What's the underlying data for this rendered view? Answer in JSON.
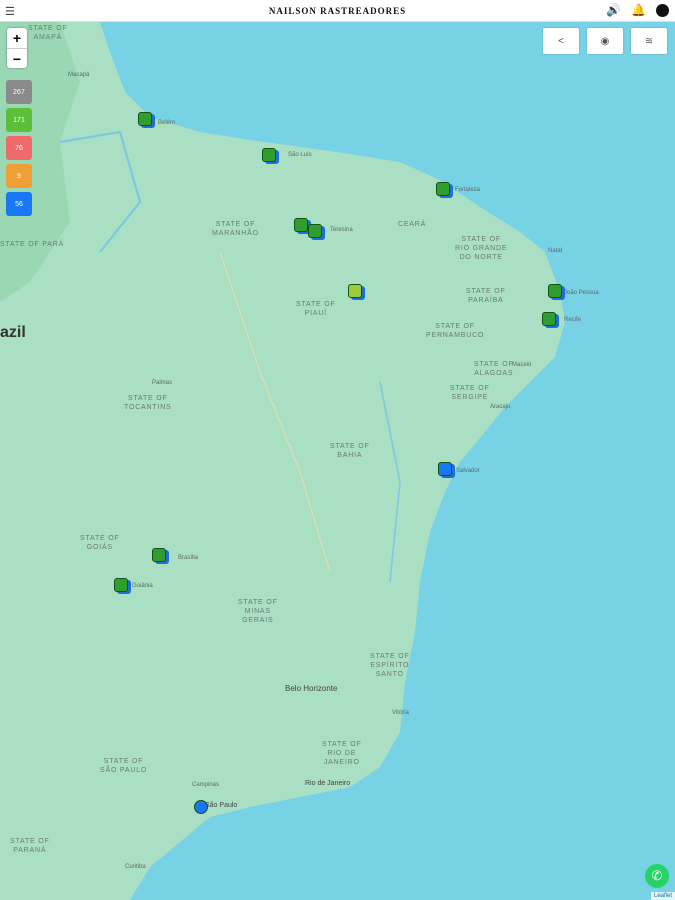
{
  "header": {
    "title": "NAILSON RASTREADORES",
    "menu_icon": "hamburger-icon",
    "sound_icon": "speaker-icon",
    "bell_icon": "bell-icon",
    "user_icon": "user-icon"
  },
  "zoom": {
    "in": "+",
    "out": "−"
  },
  "counts": [
    {
      "value": "267",
      "color": "#8a8a8a"
    },
    {
      "value": "171",
      "color": "#5cbf3a"
    },
    {
      "value": "76",
      "color": "#ef6a6a"
    },
    {
      "value": "9",
      "color": "#eea036"
    },
    {
      "value": "56",
      "color": "#1877f2"
    }
  ],
  "toolbar": {
    "share_icon": "share-icon",
    "eye_icon": "eye-icon",
    "layers_icon": "layers-icon"
  },
  "attribution": "Leaflet",
  "country_label": "azil",
  "states": [
    "STATE OF\nAMAPÁ",
    "STATE OF\nMARANHÃO",
    "CEARÁ",
    "STATE OF\nRIO GRANDE\nDO NORTE",
    "STATE OF\nPARAÍBA",
    "STATE OF\nPIAUÍ",
    "STATE OF\nPERNAMBUCO",
    "STATE OF\nALAGOAS",
    "STATE OF\nSERGIPE",
    "STATE OF\nTOCANTINS",
    "STATE OF\nBAHIA",
    "STATE OF\nGOIÁS",
    "STATE OF\nMINAS\nGERAIS",
    "STATE OF\nESPÍRITO\nSANTO",
    "STATE OF\nRIO DE\nJANEIRO",
    "STATE OF\nSÃO PAULO",
    "STATE OF\nPARANÁ",
    "STATE OF PARÁ"
  ],
  "cities": [
    "Belém",
    "São Luís",
    "Fortaleza",
    "Teresina",
    "Natal",
    "João Pessoa",
    "Recife",
    "Salvador",
    "Brasília",
    "Goiânia",
    "Belo Horizonte",
    "Rio de Janeiro",
    "São Paulo",
    "Campinas",
    "Curitiba",
    "Macapá",
    "Palmas",
    "Vitória",
    "Aracaju",
    "Maceió"
  ]
}
